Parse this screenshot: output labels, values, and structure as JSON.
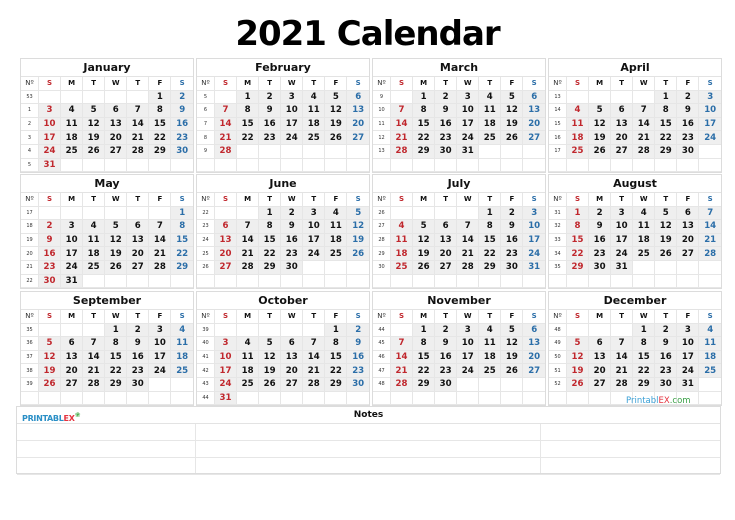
{
  "title": "2021 Calendar",
  "weekday_headers": [
    "Nº",
    "S",
    "M",
    "T",
    "W",
    "T",
    "F",
    "S"
  ],
  "colors": {
    "sunday": "#c0272d",
    "saturday": "#2b6ea8",
    "day_bg": "#efefef"
  },
  "months": [
    {
      "name": "January",
      "weeks": [
        53,
        1,
        2,
        3,
        4,
        5
      ],
      "first_dow": 5,
      "days": 31
    },
    {
      "name": "February",
      "weeks": [
        5,
        6,
        7,
        8,
        9
      ],
      "first_dow": 1,
      "days": 28
    },
    {
      "name": "March",
      "weeks": [
        9,
        10,
        11,
        12,
        13
      ],
      "first_dow": 1,
      "days": 31
    },
    {
      "name": "April",
      "weeks": [
        13,
        14,
        15,
        16,
        17
      ],
      "first_dow": 4,
      "days": 30
    },
    {
      "name": "May",
      "weeks": [
        17,
        18,
        19,
        20,
        21,
        22
      ],
      "first_dow": 6,
      "days": 31
    },
    {
      "name": "June",
      "weeks": [
        22,
        23,
        24,
        25,
        26
      ],
      "first_dow": 2,
      "days": 30
    },
    {
      "name": "July",
      "weeks": [
        26,
        27,
        28,
        29,
        30
      ],
      "first_dow": 4,
      "days": 31
    },
    {
      "name": "August",
      "weeks": [
        31,
        32,
        33,
        34,
        35
      ],
      "first_dow": 0,
      "days": 31
    },
    {
      "name": "September",
      "weeks": [
        35,
        36,
        37,
        38,
        39
      ],
      "first_dow": 3,
      "days": 30
    },
    {
      "name": "October",
      "weeks": [
        39,
        40,
        41,
        42,
        43,
        44
      ],
      "first_dow": 5,
      "days": 31
    },
    {
      "name": "November",
      "weeks": [
        44,
        45,
        46,
        47,
        48
      ],
      "first_dow": 1,
      "days": 30
    },
    {
      "name": "December",
      "weeks": [
        48,
        49,
        50,
        51,
        52
      ],
      "first_dow": 3,
      "days": 31
    }
  ],
  "notes": {
    "label": "Notes"
  },
  "logo": {
    "part1": "PRINTABL",
    "part2": "EX"
  },
  "site": {
    "part1": "Printabl",
    "part2": "EX",
    "part3": ".com"
  }
}
